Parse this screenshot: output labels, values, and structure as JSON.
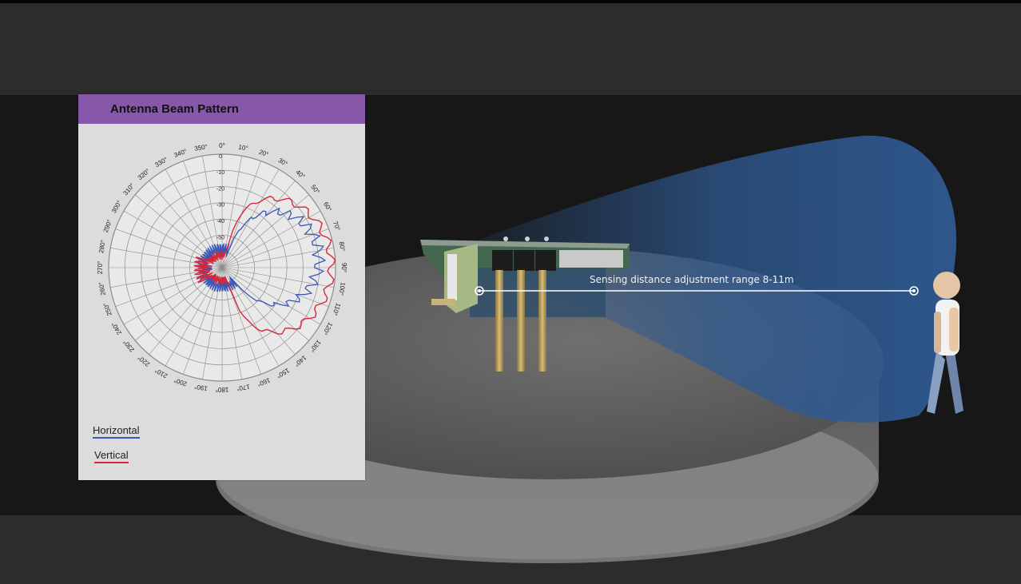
{
  "panel": {
    "title": "Antenna Beam Pattern",
    "legend": [
      {
        "label": "Horizontal",
        "color": "#3a57b6"
      },
      {
        "label": "Vertical",
        "color": "#d6283a"
      }
    ],
    "angle_labels": [
      "0°",
      "10°",
      "20°",
      "30°",
      "40°",
      "50°",
      "60°",
      "70°",
      "80°",
      "90°",
      "100°",
      "110°",
      "120°",
      "130°",
      "140°",
      "150°",
      "160°",
      "170°",
      "180°",
      "190°",
      "200°",
      "210°",
      "220°",
      "230°",
      "240°",
      "250°",
      "260°",
      "270°",
      "280°",
      "290°",
      "300°",
      "310°",
      "320°",
      "330°",
      "340°",
      "350°"
    ],
    "radial_labels": [
      "0",
      "-10",
      "-20",
      "-30",
      "-40",
      "-50",
      "-60"
    ]
  },
  "scene": {
    "range_label": "Sensing distance adjustment range 8-11m",
    "beam_color": "#2f5a92"
  }
}
